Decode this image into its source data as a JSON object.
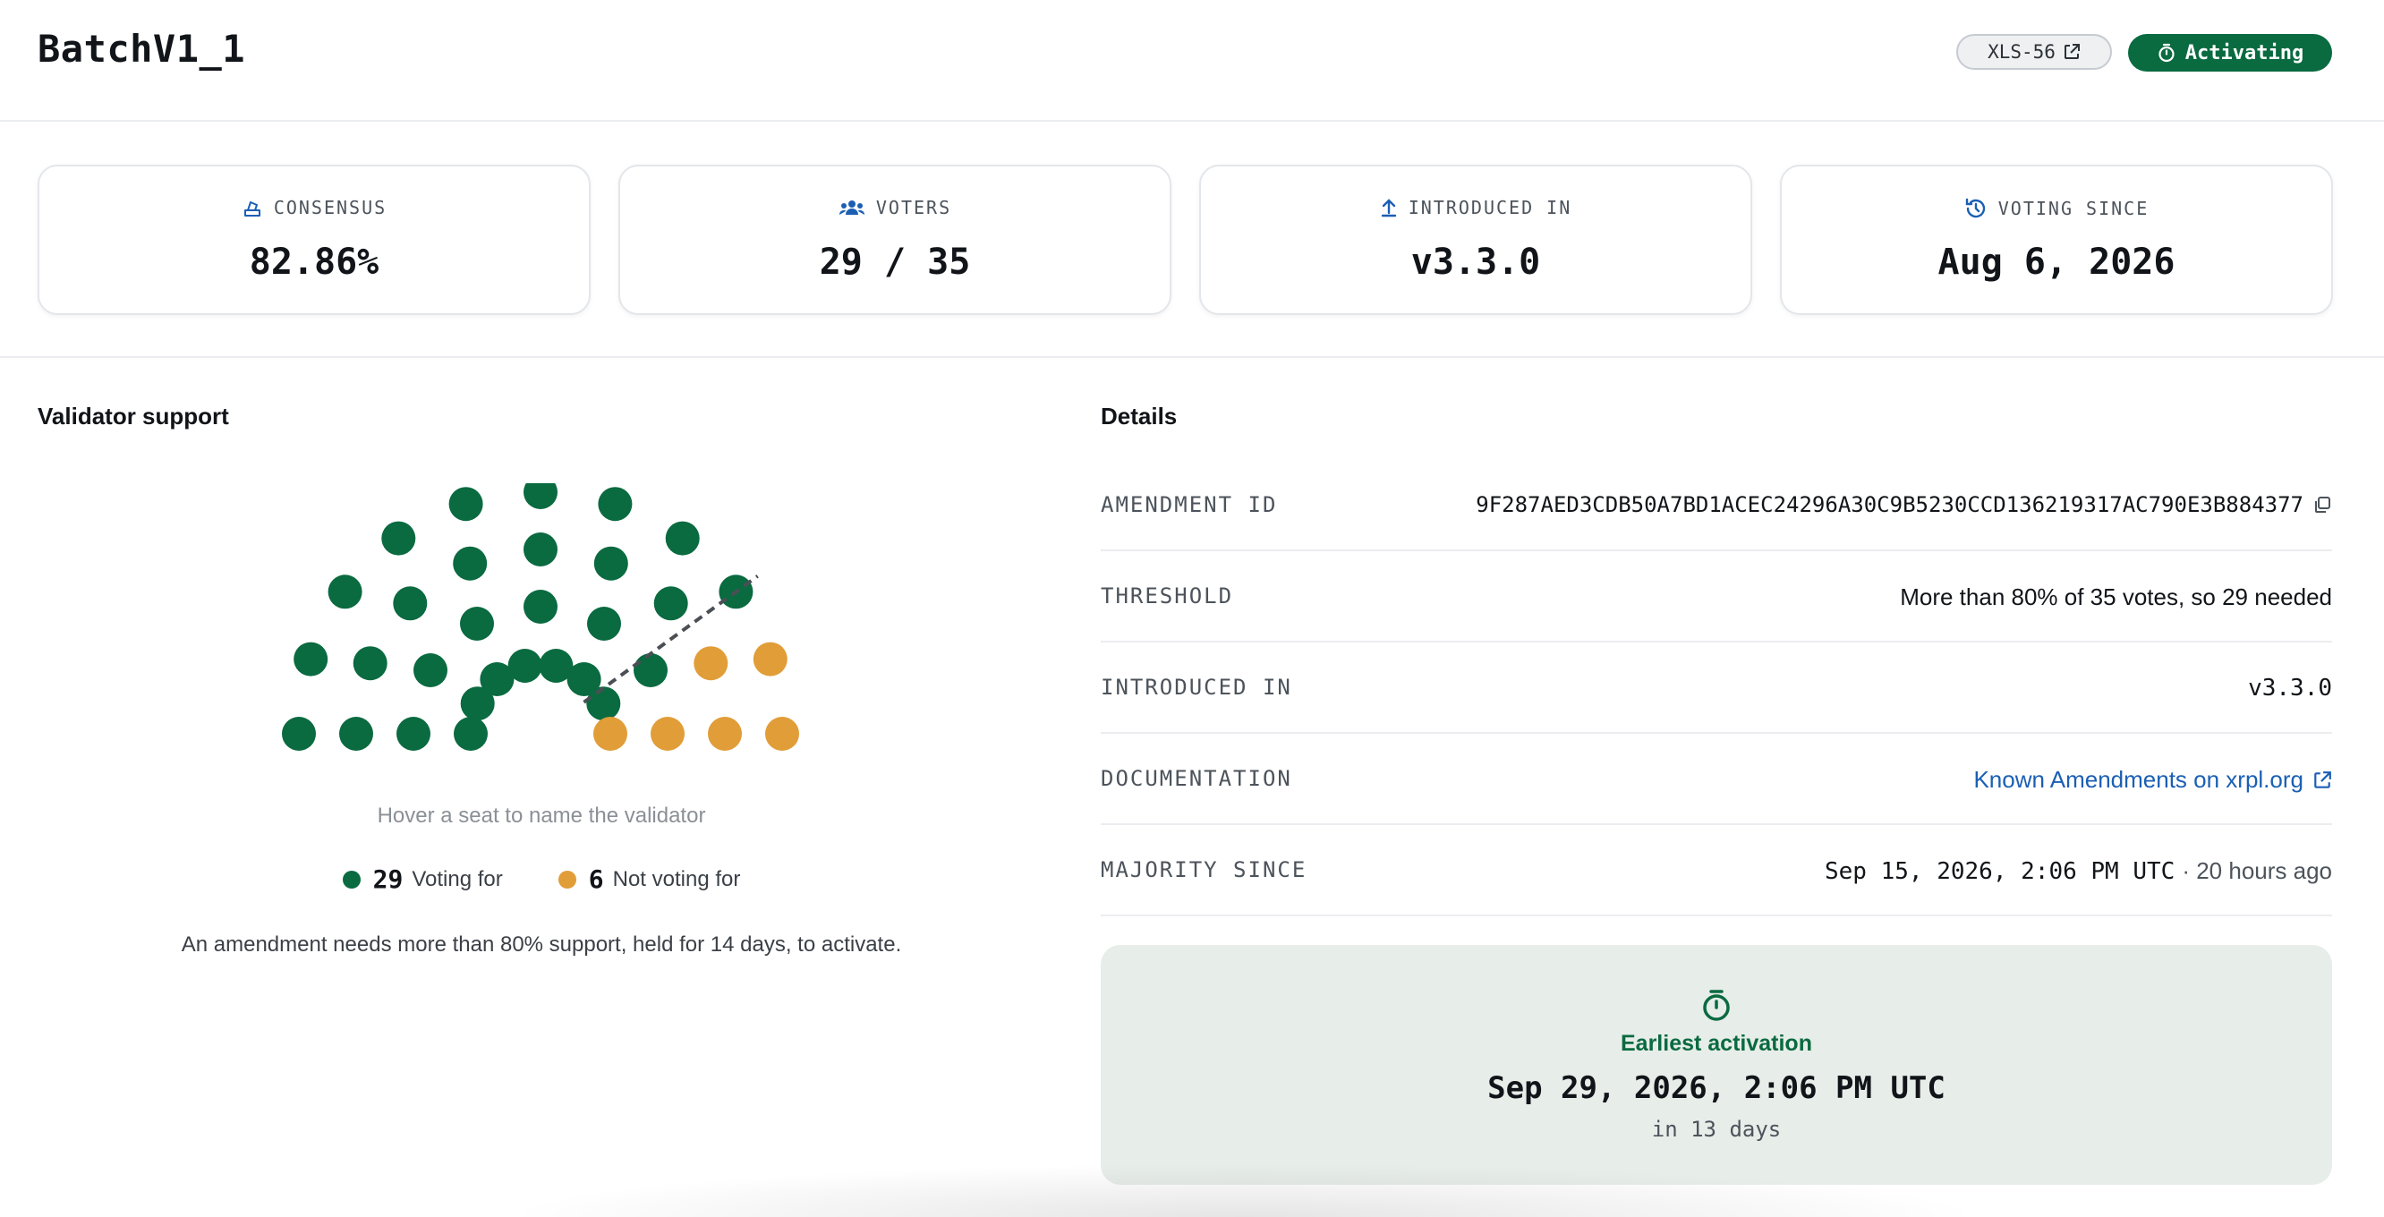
{
  "header": {
    "title": "BatchV1_1",
    "xls_badge": "XLS-56",
    "status": "Activating"
  },
  "stats": [
    {
      "label": "CONSENSUS",
      "value": "82.86%",
      "icon": "ballot-icon"
    },
    {
      "label": "VOTERS",
      "value": "29 / 35",
      "icon": "users-icon"
    },
    {
      "label": "INTRODUCED IN",
      "value": "v3.3.0",
      "icon": "upload-arrow-icon"
    },
    {
      "label": "VOTING SINCE",
      "value": "Aug 6, 2026",
      "icon": "history-icon"
    }
  ],
  "validator_support": {
    "title": "Validator support",
    "hover_hint": "Hover a seat to name the validator",
    "voting_for_count": "29",
    "voting_for_label": "Voting for",
    "not_voting_count": "6",
    "not_voting_label": "Not voting for",
    "note": "An amendment needs more than 80% support, held for 14 days, to activate.",
    "colors": {
      "for": "#0a6a40",
      "against": "#e19d38"
    }
  },
  "details": {
    "title": "Details",
    "rows": [
      {
        "label": "AMENDMENT ID",
        "value": "9F287AED3CDB50A7BD1ACEC24296A30C9B5230CCD136219317AC790E3B884377"
      },
      {
        "label": "THRESHOLD",
        "value": "More than 80% of 35 votes, so 29 needed"
      },
      {
        "label": "INTRODUCED IN",
        "value": "v3.3.0"
      },
      {
        "label": "DOCUMENTATION",
        "value": "Known Amendments on xrpl.org"
      },
      {
        "label": "MAJORITY SINCE",
        "value": "Sep 15, 2026, 2:06 PM UTC",
        "relative": "· 20 hours ago"
      }
    ]
  },
  "activation": {
    "label": "Earliest activation",
    "date": "Sep 29, 2026, 2:06 PM UTC",
    "relative": "in 13 days"
  }
}
